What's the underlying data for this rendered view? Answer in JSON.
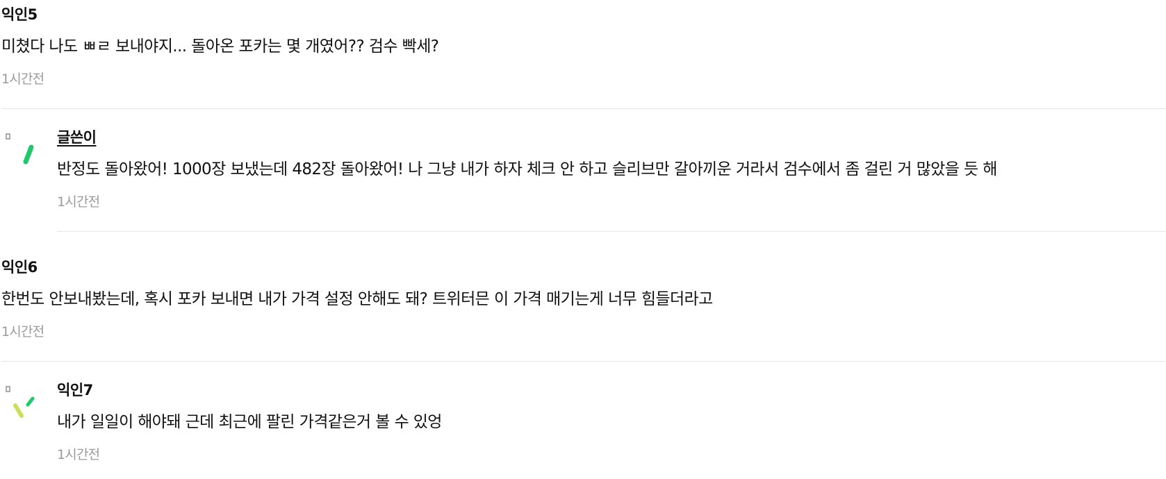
{
  "comments": [
    {
      "author": "익인5",
      "body": "미쳤다 나도 ㅃㄹ 보내야지... 돌아온 포카는 몇 개였어?? 검수 빡세?",
      "time": "1시간전"
    },
    {
      "author": "글쓴이",
      "body": "반정도 돌아왔어! 1000장 보냈는데 482장 돌아왔어! 나 그냥 내가 하자 체크 안 하고 슬리브만 갈아끼운 거라서 검수에서 좀 걸린 거 많았을 듯 해",
      "time": "1시간전",
      "is_reply": true,
      "is_op": true
    },
    {
      "author": "익인6",
      "body": "한번도 안보내봤는데, 혹시 포카 보내면 내가 가격 설정 안해도 돼? 트위터믄 이 가격 매기는게 너무 힘들더라고",
      "time": "1시간전"
    },
    {
      "author": "익인7",
      "body": "내가 일일이 해야돼 근데 최근에 팔린 가격같은거 볼 수 있엉",
      "time": "1시간전",
      "is_reply": true
    }
  ],
  "colors": {
    "text": "#111111",
    "time": "#9a9a9a",
    "divider": "#e6e6e6",
    "reply_icon_gray": "#aaaaaa",
    "reply_icon_green": "#1fc86a",
    "reply_icon_lime": "#c8e05a"
  },
  "icons": {
    "reply_indicator": "reply-arrow-icon"
  }
}
